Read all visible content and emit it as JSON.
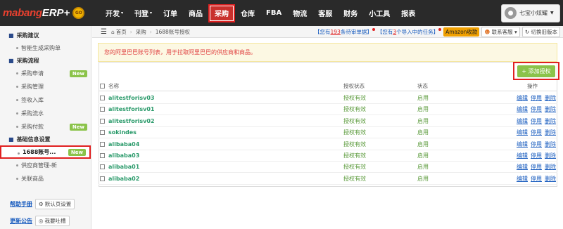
{
  "logo": {
    "brand_main": "mabang",
    "brand_sub": "ERP+",
    "badge": "GO"
  },
  "nav": [
    {
      "label": "开发",
      "caret": "▾"
    },
    {
      "label": "刊登",
      "caret": "▾"
    },
    {
      "label": "订单",
      "caret": ""
    },
    {
      "label": "商品",
      "caret": ""
    },
    {
      "label": "采购",
      "caret": "",
      "active": true
    },
    {
      "label": "仓库",
      "caret": ""
    },
    {
      "label": "FBA",
      "caret": ""
    },
    {
      "label": "物流",
      "caret": ""
    },
    {
      "label": "客服",
      "caret": ""
    },
    {
      "label": "财务",
      "caret": ""
    },
    {
      "label": "小工具",
      "caret": ""
    },
    {
      "label": "报表",
      "caret": ""
    }
  ],
  "user": {
    "name": "七宝小炫耀"
  },
  "sidebar": {
    "sections": [
      {
        "title": "采购建议",
        "items": [
          {
            "label": "智能生成采购单",
            "new": ""
          }
        ]
      },
      {
        "title": "采购流程",
        "items": [
          {
            "label": "采购申请",
            "new": "New"
          },
          {
            "label": "采购管理",
            "new": ""
          },
          {
            "label": "签收入库",
            "new": ""
          },
          {
            "label": "采购流水",
            "new": ""
          },
          {
            "label": "采购付款",
            "new": "New"
          }
        ]
      },
      {
        "title": "基础信息设置",
        "items": [
          {
            "label": "1688账号...",
            "new": "New",
            "selected": true
          },
          {
            "label": "供应商管理-新",
            "new": ""
          },
          {
            "label": "关联商品",
            "new": ""
          }
        ]
      }
    ],
    "help_link": "帮助手册",
    "default_page": "默认页设置",
    "announce_link": "更新公告",
    "feedback": "我要吐槽"
  },
  "breadcrumb": {
    "home": "首页",
    "level1": "采购",
    "current": "1688账号授权"
  },
  "topright": {
    "pending_prefix": "【您有",
    "pending_count": "193",
    "pending_suffix": "条待审单据】",
    "import_prefix": "【您有",
    "import_count": "3",
    "import_suffix": "个导入中的任务】",
    "amazon": "Amazon收款",
    "support": "联系客服",
    "switch": "切换旧版本"
  },
  "alert": "您的阿里巴巴账号列表，用于拉取阿里巴巴的供应商和商品。",
  "add_button": "+ 添加授权",
  "table": {
    "headers": {
      "name": "名称",
      "auth": "授权状态",
      "status": "状态",
      "ops": "操作"
    },
    "rows": [
      {
        "name": "alitestforisv03",
        "auth": "授权有效",
        "status": "启用"
      },
      {
        "name": "alitestforisv01",
        "auth": "授权有效",
        "status": "启用"
      },
      {
        "name": "alitestforisv02",
        "auth": "授权有效",
        "status": "启用"
      },
      {
        "name": "sokindes",
        "auth": "授权有效",
        "status": "启用"
      },
      {
        "name": "alibaba04",
        "auth": "授权有效",
        "status": "启用"
      },
      {
        "name": "alibaba03",
        "auth": "授权有效",
        "status": "启用"
      },
      {
        "name": "alibaba01",
        "auth": "授权有效",
        "status": "启用"
      },
      {
        "name": "alibaba02",
        "auth": "授权有效",
        "status": "启用"
      }
    ],
    "ops": {
      "edit": "编辑",
      "disable": "停用",
      "delete": "删除"
    }
  },
  "colors": {
    "topbar": "#2a2a2a",
    "active_nav": "#c9302c",
    "highlight": "#e02020",
    "new_badge": "#8bc34a",
    "link": "#1a5dbf",
    "row_name": "#2a9a6a"
  }
}
